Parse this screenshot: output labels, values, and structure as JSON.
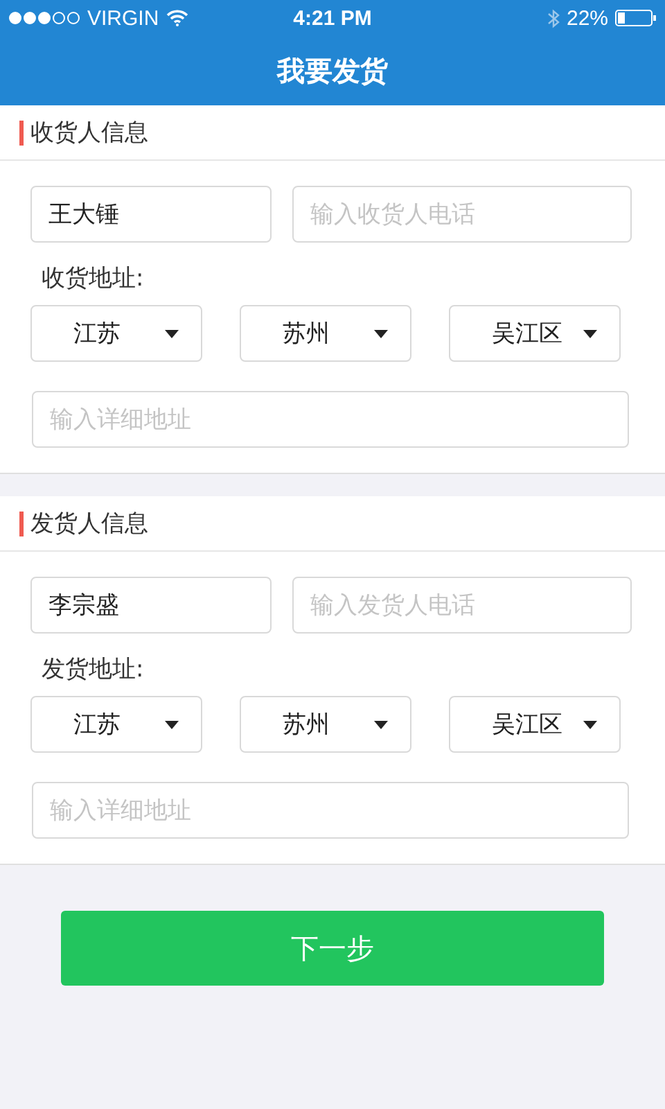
{
  "status_bar": {
    "carrier": "VIRGIN",
    "time": "4:21 PM",
    "battery": "22%"
  },
  "nav": {
    "title": "我要发货"
  },
  "sections": [
    {
      "title": "收货人信息",
      "name": {
        "value": "王大锤"
      },
      "phone": {
        "placeholder": "输入收货人电话"
      },
      "address_label": "收货地址:",
      "selects": [
        "江苏",
        "苏州",
        "吴江区"
      ],
      "detail": {
        "placeholder": "输入详细地址"
      }
    },
    {
      "title": "发货人信息",
      "name": {
        "value": "李宗盛"
      },
      "phone": {
        "placeholder": "输入发货人电话"
      },
      "address_label": "发货地址:",
      "selects": [
        "江苏",
        "苏州",
        "吴江区"
      ],
      "detail": {
        "placeholder": "输入详细地址"
      }
    }
  ],
  "next_button": "下一步"
}
